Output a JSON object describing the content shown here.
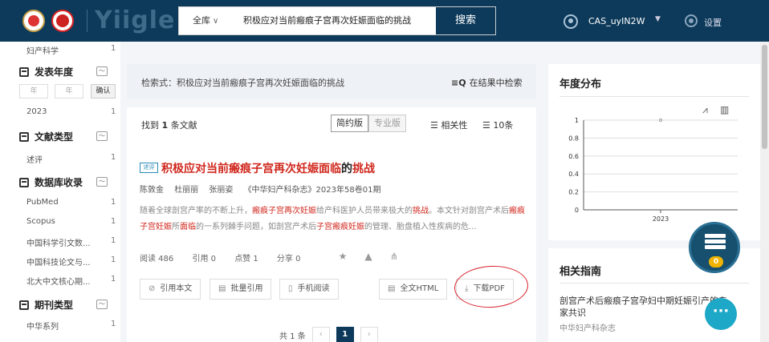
{
  "header": {
    "brand": "Yiigle",
    "search_scope": "全库",
    "search_query": "积极应对当前瘢痕子宫再次妊娠面临的挑战",
    "search_button": "搜索",
    "user_name": "CAS_uyIN2W",
    "settings_label": "设置"
  },
  "sidebar": {
    "top_item": {
      "label": "妇产科学",
      "count": "1"
    },
    "year_section": {
      "title": "发表年度",
      "year_placeholder": "年",
      "confirm": "确认",
      "items": [
        {
          "label": "2023",
          "count": "1"
        }
      ]
    },
    "type_section": {
      "title": "文献类型",
      "items": [
        {
          "label": "述评",
          "count": "1"
        }
      ]
    },
    "db_section": {
      "title": "数据库收录",
      "items": [
        {
          "label": "PubMed",
          "count": "1"
        },
        {
          "label": "Scopus",
          "count": "1"
        },
        {
          "label": "中国科学引文数...",
          "count": "1"
        },
        {
          "label": "中国科技论文与...",
          "count": "1"
        },
        {
          "label": "北大中文核心期...",
          "count": "1"
        }
      ]
    },
    "journal_section": {
      "title": "期刊类型",
      "items": [
        {
          "label": "中华系列",
          "count": "1"
        }
      ]
    }
  },
  "main": {
    "expression": "检索式：积极应对当前瘢痕子宫再次妊娠面临的挑战",
    "refine": "在结果中检索",
    "found_prefix": "找到",
    "found_count": "1",
    "found_suffix": "条文献",
    "view_simple": "简约版",
    "view_pro": "专业版",
    "sort": "相关性",
    "per_page": "10条",
    "result": {
      "tag": "述评",
      "title_hl": "积极应对当前瘢痕子宫再次妊娠面临",
      "title_mid": "的",
      "title_hl2": "挑战",
      "authors": [
        "陈敦金",
        "杜丽丽",
        "张丽姿"
      ],
      "journal": "《中华妇产科杂志》2023年58卷01期",
      "abstract_line1_a": "随着全球剖宫产率的不断上升，",
      "abstract_line1_hl": "瘢痕子宫再次妊娠",
      "abstract_line1_b": "给产科医护人员带来极大的",
      "abstract_line1_hl2": "挑战",
      "abstract_line1_c": "。本文针对剖宫产术",
      "abstract_line2_a": "后",
      "abstract_line2_hl": "瘢痕子宫妊娠",
      "abstract_line2_b": "所",
      "abstract_line2_hl2": "面临",
      "abstract_line2_c": "的一系列棘手问题，如剖宫产术后",
      "abstract_line2_hl3": "子宫瘢痕妊娠",
      "abstract_line2_d": "的管理、胎盘植入性疾病的危...",
      "reads": "阅读 486",
      "cites": "引用 0",
      "likes": "点赞 1",
      "shares": "分享 0",
      "btn_cite": "引用本文",
      "btn_batch": "批量引用",
      "btn_mobile": "手机阅读",
      "btn_html": "全文HTML",
      "btn_pdf": "下载PDF"
    },
    "pager": {
      "total": "共 1 条",
      "prev": "‹",
      "current": "1",
      "next": "›"
    }
  },
  "right": {
    "year_dist_title": "年度分布",
    "guide_title": "相关指南",
    "guide_item": "剖宫产术后瘢痕子宫孕妇中期妊娠引产的专家共识",
    "guide_source": "中华妇产科杂志",
    "float_badge": "0",
    "chat": "···"
  },
  "chart_data": {
    "type": "line",
    "x": [
      "2023"
    ],
    "y": [
      1
    ],
    "ylim": [
      0,
      1
    ],
    "yticks": [
      "0",
      "0.2",
      "0.4",
      "0.6",
      "0.8",
      "1"
    ],
    "grid": true
  }
}
